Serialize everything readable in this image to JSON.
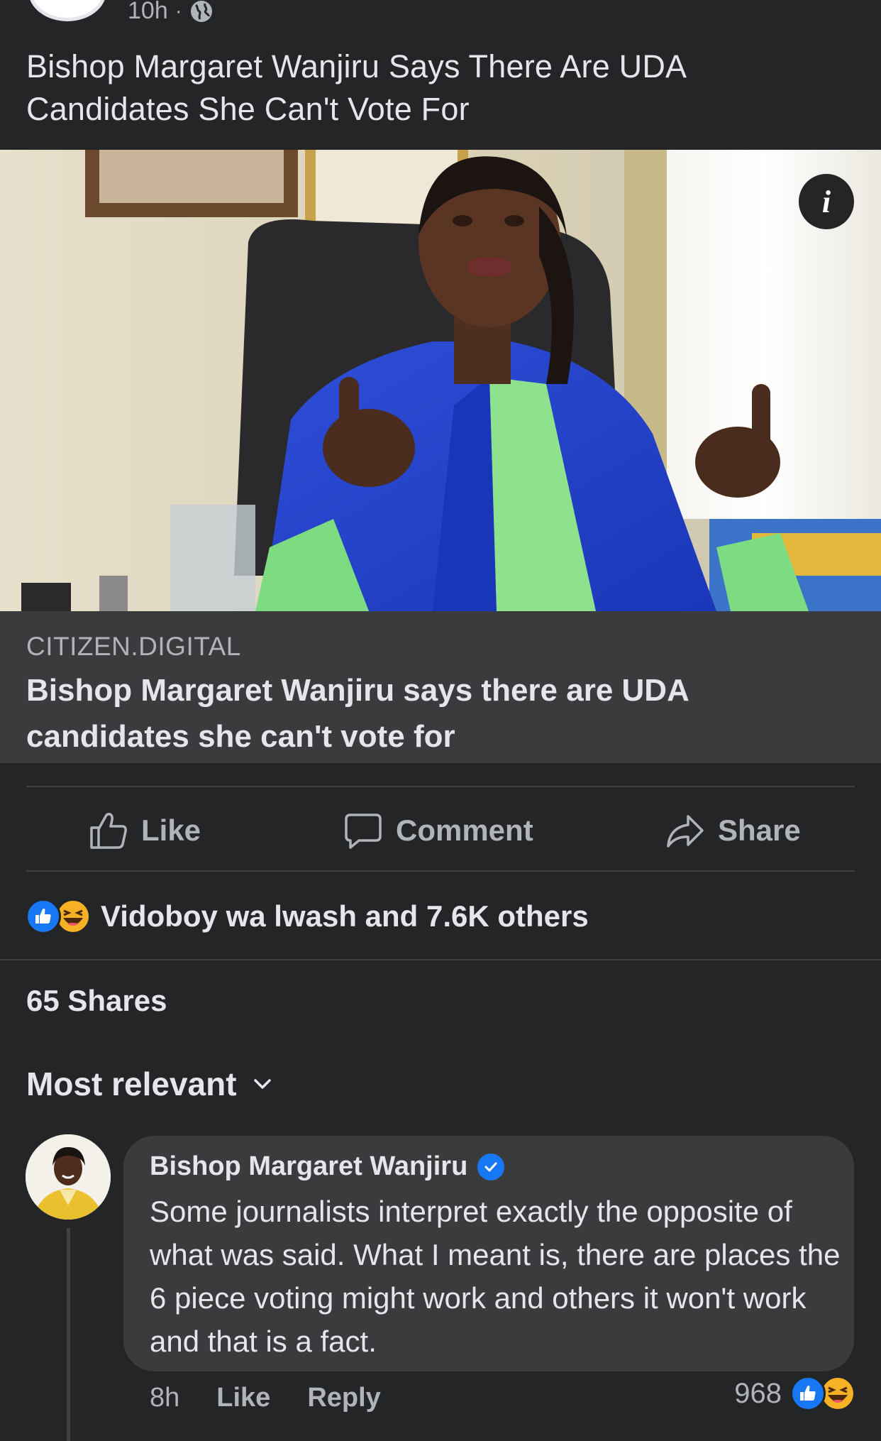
{
  "post": {
    "time": "10h",
    "separator": "·",
    "privacy_icon": "globe-icon",
    "text": "Bishop Margaret Wanjiru Says There Are UDA Candidates She Can't Vote For"
  },
  "link": {
    "image_alt": "Bishop Margaret Wanjiru seated in office wearing blue jacket and green top",
    "domain": "CITIZEN.DIGITAL",
    "title": "Bishop Margaret Wanjiru says there are UDA candidates she can't vote for",
    "info_icon": "info-icon"
  },
  "actions": {
    "like_label": "Like",
    "comment_label": "Comment",
    "share_label": "Share"
  },
  "reactions": {
    "summary": "Vidoboy wa lwash and 7.6K others",
    "types": [
      "like",
      "haha"
    ]
  },
  "shares": "65 Shares",
  "sort": {
    "label": "Most relevant"
  },
  "comment": {
    "author": "Bishop Margaret Wanjiru",
    "verified": true,
    "text": "Some journalists interpret exactly the opposite of what was said. What I meant is, there are places the 6 piece voting might work and others it won't work and that is a fact.",
    "time": "8h",
    "like_label": "Like",
    "reply_label": "Reply",
    "reaction_count": "968"
  },
  "colors": {
    "background": "#242526",
    "card": "#3a3b3c",
    "text_primary": "#e4e6eb",
    "text_secondary": "#b0b3b8",
    "accent_blue": "#1877f2",
    "haha_yellow": "#f7b125"
  }
}
